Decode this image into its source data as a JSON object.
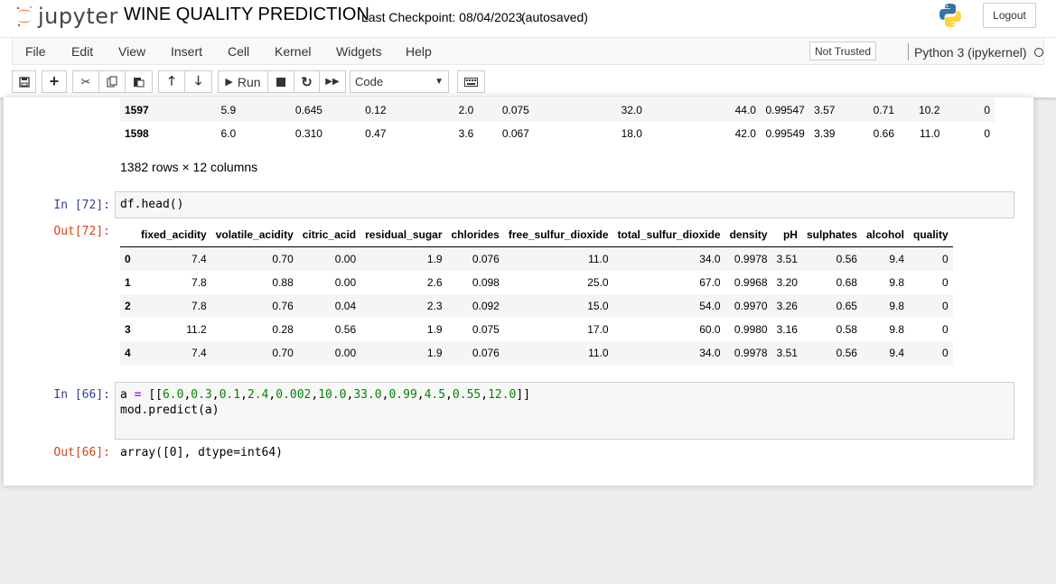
{
  "header": {
    "logo_text": "jupyter",
    "notebook_title": "WINE QUALITY PREDICTION",
    "checkpoint": "Last Checkpoint: 08/04/2023",
    "autosave": "(autosaved)",
    "logout_label": "Logout"
  },
  "menu": {
    "items": [
      "File",
      "Edit",
      "View",
      "Insert",
      "Cell",
      "Kernel",
      "Widgets",
      "Help"
    ],
    "trust_label": "Not Trusted",
    "kernel_label": "Python 3 (ipykernel)"
  },
  "toolbar": {
    "run_label": "Run",
    "cell_type": "Code"
  },
  "prev_table": {
    "rows": [
      [
        "1597",
        "5.9",
        "0.645",
        "0.12",
        "2.0",
        "0.075",
        "32.0",
        "44.0",
        "0.99547",
        "3.57",
        "0.71",
        "10.2",
        "0"
      ],
      [
        "1598",
        "6.0",
        "0.310",
        "0.47",
        "3.6",
        "0.067",
        "18.0",
        "42.0",
        "0.99549",
        "3.39",
        "0.66",
        "11.0",
        "0"
      ]
    ],
    "summary": "1382 rows × 12 columns"
  },
  "cell_head": {
    "in_prompt": "In [72]:",
    "code": "df.head()",
    "out_prompt": "Out[72]:",
    "columns": [
      "",
      "fixed_acidity",
      "volatile_acidity",
      "citric_acid",
      "residual_sugar",
      "chlorides",
      "free_sulfur_dioxide",
      "total_sulfur_dioxide",
      "density",
      "pH",
      "sulphates",
      "alcohol",
      "quality"
    ],
    "rows": [
      [
        "0",
        "7.4",
        "0.70",
        "0.00",
        "1.9",
        "0.076",
        "11.0",
        "34.0",
        "0.9978",
        "3.51",
        "0.56",
        "9.4",
        "0"
      ],
      [
        "1",
        "7.8",
        "0.88",
        "0.00",
        "2.6",
        "0.098",
        "25.0",
        "67.0",
        "0.9968",
        "3.20",
        "0.68",
        "9.8",
        "0"
      ],
      [
        "2",
        "7.8",
        "0.76",
        "0.04",
        "2.3",
        "0.092",
        "15.0",
        "54.0",
        "0.9970",
        "3.26",
        "0.65",
        "9.8",
        "0"
      ],
      [
        "3",
        "11.2",
        "0.28",
        "0.56",
        "1.9",
        "0.075",
        "17.0",
        "60.0",
        "0.9980",
        "3.16",
        "0.58",
        "9.8",
        "0"
      ],
      [
        "4",
        "7.4",
        "0.70",
        "0.00",
        "1.9",
        "0.076",
        "11.0",
        "34.0",
        "0.9978",
        "3.51",
        "0.56",
        "9.4",
        "0"
      ]
    ]
  },
  "cell_predict": {
    "in_prompt": "In [66]:",
    "line1_var": "a",
    "line1_eq": "=",
    "line1_open": "[[",
    "line1_nums": [
      "6.0",
      "0.3",
      "0.1",
      "2.4",
      "0.002",
      "10.0",
      "33.0",
      "0.99",
      "4.5",
      "0.55",
      "12.0"
    ],
    "line1_close": "]]",
    "line2": "mod.predict(a)",
    "out_prompt": "Out[66]:",
    "output": "array([0], dtype=int64)"
  }
}
